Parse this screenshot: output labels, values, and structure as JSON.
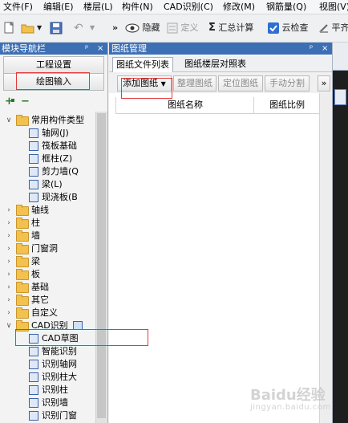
{
  "menubar": {
    "items": [
      {
        "label": "文件(F)"
      },
      {
        "label": "编辑(E)"
      },
      {
        "label": "楼层(L)"
      },
      {
        "label": "构件(N)"
      },
      {
        "label": "CAD识别(C)"
      },
      {
        "label": "修改(M)"
      },
      {
        "label": "钢筋量(Q)"
      },
      {
        "label": "视图(V)"
      }
    ]
  },
  "toolbar": {
    "overflow": "»",
    "hide_label": "隐藏",
    "define_label": "定义",
    "sum_label": "汇总计算",
    "cloud_check_label": "云检查",
    "flat_label": "平齐"
  },
  "left_panel": {
    "title": "模块导航栏",
    "pin": "ᵖ",
    "close": "×",
    "project_settings": "工程设置",
    "draw_input": "绘图输入",
    "tree": [
      {
        "label": "常用构件类型",
        "type": "folder",
        "expander": "-"
      },
      {
        "label": "轴网(J)",
        "type": "leaf"
      },
      {
        "label": "筏板基础",
        "type": "leaf"
      },
      {
        "label": "框柱(Z)",
        "type": "leaf"
      },
      {
        "label": "剪力墙(Q",
        "type": "leaf"
      },
      {
        "label": "梁(L)",
        "type": "leaf"
      },
      {
        "label": "现浇板(B",
        "type": "leaf"
      },
      {
        "label": "轴线",
        "type": "folder",
        "expander": ">"
      },
      {
        "label": "柱",
        "type": "folder",
        "expander": ">"
      },
      {
        "label": "墙",
        "type": "folder",
        "expander": ">"
      },
      {
        "label": "门窗洞",
        "type": "folder",
        "expander": ">"
      },
      {
        "label": "梁",
        "type": "folder",
        "expander": ">"
      },
      {
        "label": "板",
        "type": "folder",
        "expander": ">"
      },
      {
        "label": "基础",
        "type": "folder",
        "expander": ">"
      },
      {
        "label": "其它",
        "type": "folder",
        "expander": ">"
      },
      {
        "label": "自定义",
        "type": "folder",
        "expander": ">"
      },
      {
        "label": "CAD识别",
        "type": "folder",
        "expander": "-"
      },
      {
        "label": "CAD草图",
        "type": "leaf"
      },
      {
        "label": "智能识别",
        "type": "leaf"
      },
      {
        "label": "识别轴网",
        "type": "leaf"
      },
      {
        "label": "识别柱大",
        "type": "leaf"
      },
      {
        "label": "识别柱",
        "type": "leaf"
      },
      {
        "label": "识别墙",
        "type": "leaf"
      },
      {
        "label": "识别门窗",
        "type": "leaf"
      }
    ]
  },
  "center_panel": {
    "title": "图纸管理",
    "tabs": [
      {
        "label": "图纸文件列表"
      },
      {
        "label": "图纸楼层对照表"
      }
    ],
    "buttons": {
      "add": "添加图纸",
      "organize": "整理图纸",
      "locate": "定位图纸",
      "split": "手动分割",
      "more": "»"
    },
    "table": {
      "columns": [
        "图纸名称",
        "图纸比例"
      ]
    }
  },
  "watermark": {
    "text": "Baidu经验",
    "sub": "jingyan.baidu.com"
  },
  "colors": {
    "title_bar": "#3d6fb4",
    "highlight": "#e23a3a"
  }
}
